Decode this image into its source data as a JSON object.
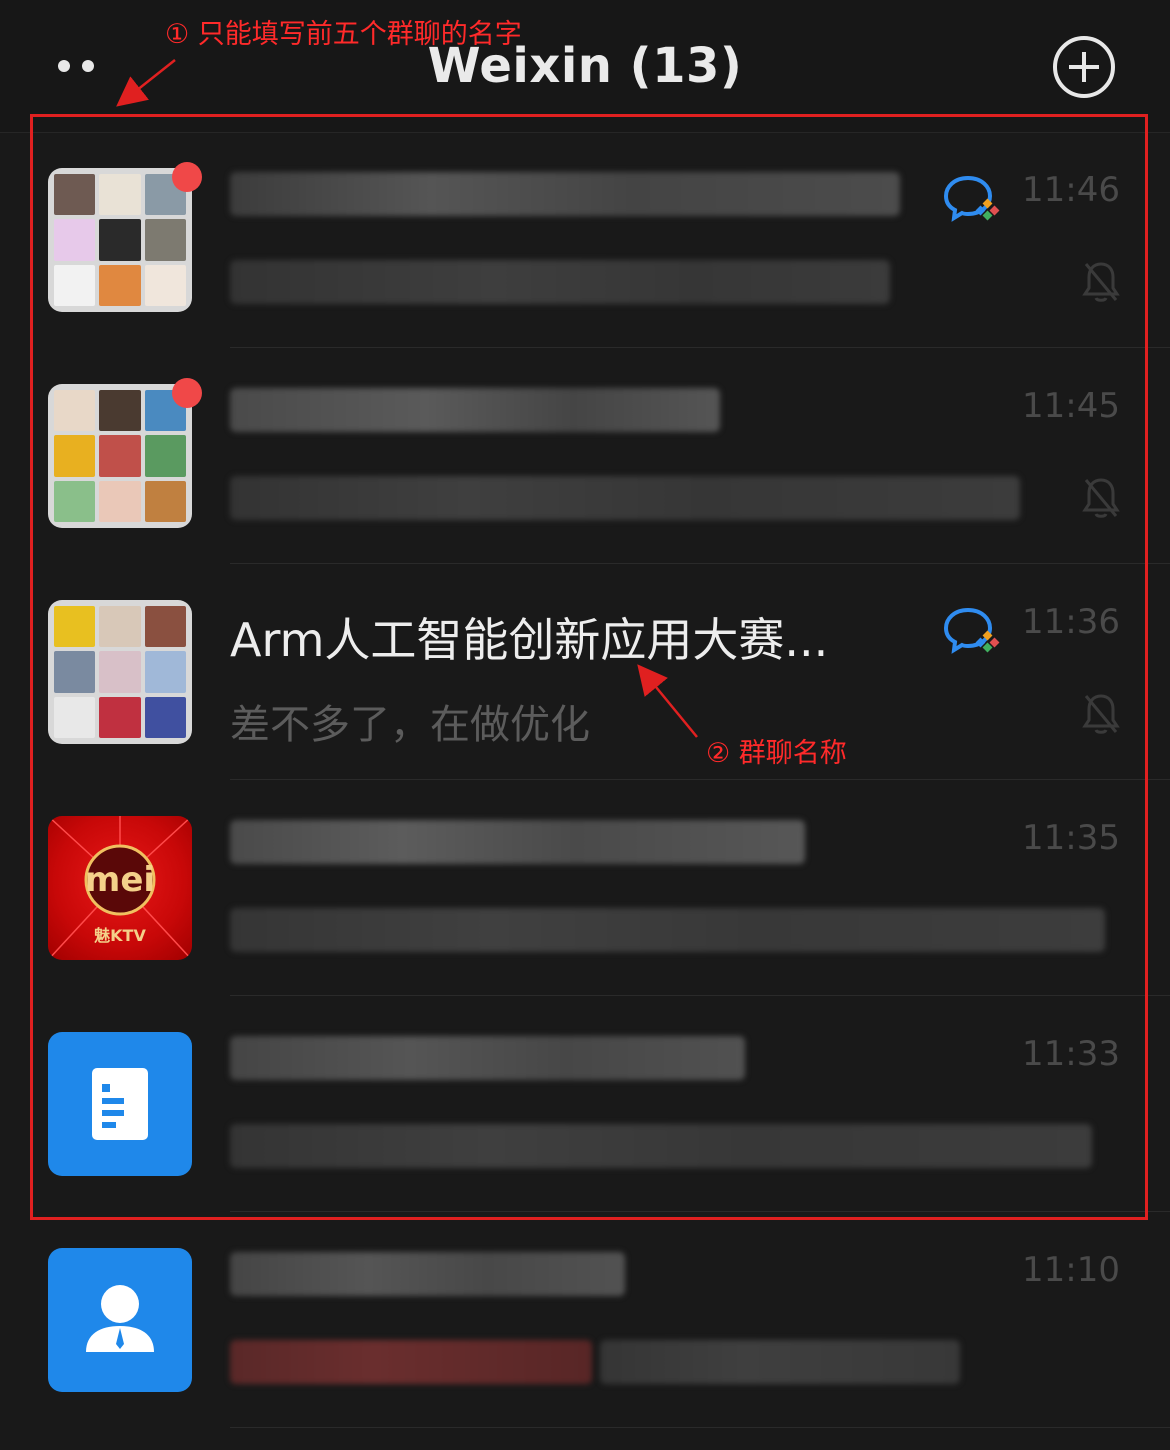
{
  "header": {
    "title": "Weixin (13)"
  },
  "annotations": {
    "note1": "① 只能填写前五个群聊的名字",
    "note2": "② 群聊名称"
  },
  "chats": [
    {
      "time": "11:46",
      "name": "",
      "message": ""
    },
    {
      "time": "11:45",
      "name": "",
      "message": ""
    },
    {
      "time": "11:36",
      "name": "Arm人工智能创新应用大赛...",
      "message": "差不多了，在做优化"
    },
    {
      "time": "11:35",
      "name": "",
      "message": "",
      "avatar_text": "mei",
      "avatar_subtext": "魅KTV"
    },
    {
      "time": "11:33",
      "name": "",
      "message": ""
    },
    {
      "time": "11:10",
      "name": "",
      "message": ""
    }
  ],
  "colors": {
    "background": "#191919",
    "annotation_red": "#e02020",
    "unread_dot": "#f04848",
    "app_blue": "#1f88ea"
  }
}
